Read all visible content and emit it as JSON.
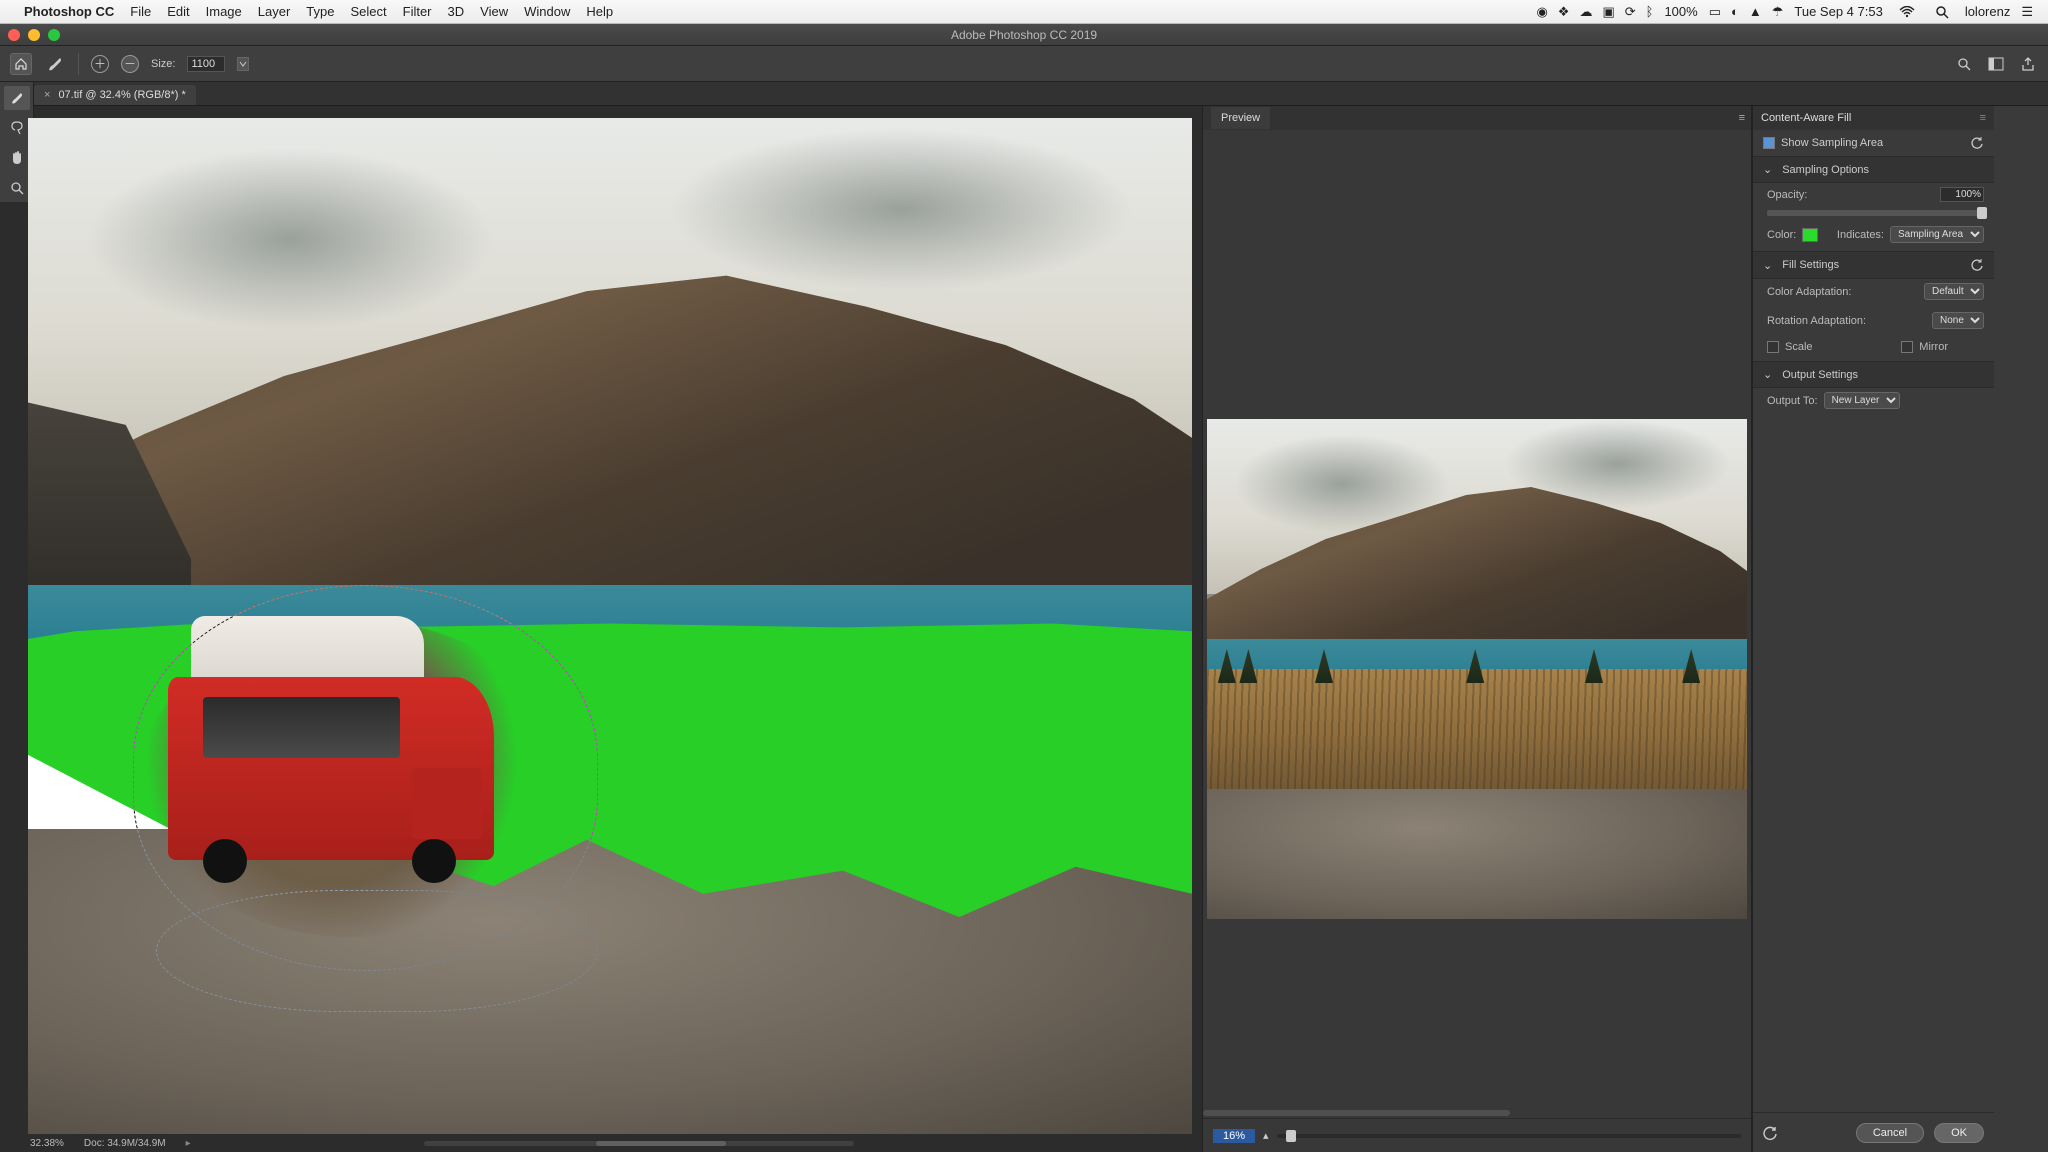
{
  "menubar": {
    "app": "Photoshop CC",
    "items": [
      "File",
      "Edit",
      "Image",
      "Layer",
      "Type",
      "Select",
      "Filter",
      "3D",
      "View",
      "Window",
      "Help"
    ],
    "battery": "100%",
    "datetime": "Tue Sep 4  7:53",
    "user": "lolorenz"
  },
  "window": {
    "title": "Adobe Photoshop CC 2019"
  },
  "optbar": {
    "size_label": "Size:",
    "size_value": "1100"
  },
  "doc_tab": {
    "label": "07.tif @ 32.4% (RGB/8*) *"
  },
  "status": {
    "zoom": "32.38%",
    "doc": "Doc: 34.9M/34.9M"
  },
  "preview": {
    "tab": "Preview",
    "zoom": "16%"
  },
  "caf": {
    "title": "Content-Aware Fill",
    "show_sampling": "Show Sampling Area",
    "sampling_header": "Sampling Options",
    "opacity_label": "Opacity:",
    "opacity_value": "100%",
    "color_label": "Color:",
    "indicates_label": "Indicates:",
    "indicates_value": "Sampling Area",
    "fill_header": "Fill Settings",
    "color_adapt_label": "Color Adaptation:",
    "color_adapt_value": "Default",
    "rotation_label": "Rotation Adaptation:",
    "rotation_value": "None",
    "scale_label": "Scale",
    "mirror_label": "Mirror",
    "output_header": "Output Settings",
    "output_to_label": "Output To:",
    "output_to_value": "New Layer",
    "cancel": "Cancel",
    "ok": "OK"
  }
}
